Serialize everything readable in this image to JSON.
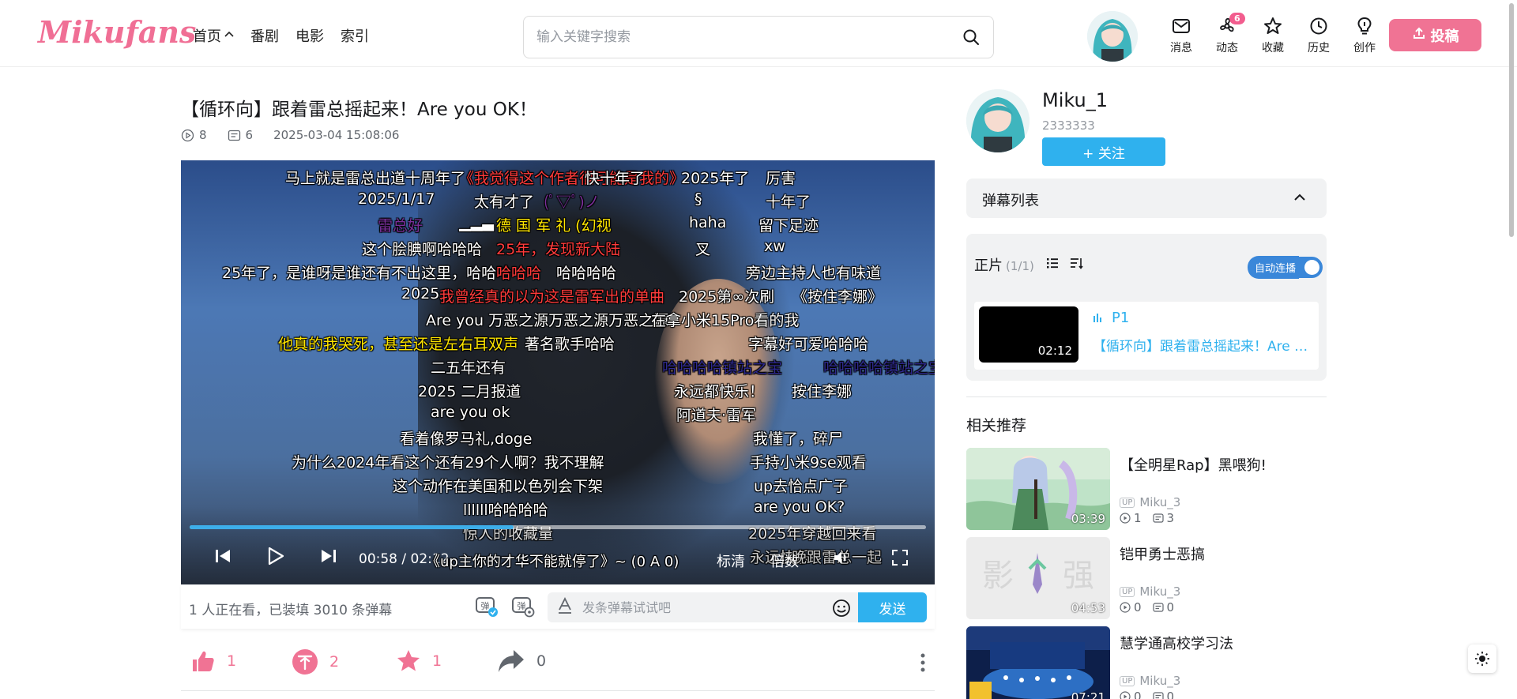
{
  "header": {
    "logo": "Mikufans",
    "nav": [
      {
        "label": "首页"
      },
      {
        "label": "番剧"
      },
      {
        "label": "电影"
      },
      {
        "label": "索引"
      }
    ],
    "search_placeholder": "输入关键字搜索",
    "actions": [
      {
        "label": "消息",
        "icon": "mail-icon"
      },
      {
        "label": "动态",
        "icon": "fan-icon",
        "badge": "6"
      },
      {
        "label": "收藏",
        "icon": "star-icon"
      },
      {
        "label": "历史",
        "icon": "clock-icon"
      },
      {
        "label": "创作",
        "icon": "bulb-icon"
      }
    ],
    "upload_label": "投稿"
  },
  "video": {
    "title": "【循环向】跟着雷总摇起来！Are you OK！",
    "plays": "8",
    "danmaku_count": "6",
    "date": "2025-03-04 15:08:06"
  },
  "player": {
    "current_time": "00:58",
    "duration": "02:12",
    "progress_fraction": 0.44,
    "quality": "标清",
    "speed": "倍数",
    "scrolling_danmaku": "《up主你的才华不能就停了》~  (0 A 0)",
    "danmaku": [
      {
        "text": "马上就是雷总出道十周年了",
        "color": "white"
      },
      {
        "text": "《我觉得这个作者很可能是我的》",
        "color": "red"
      },
      {
        "text": "快十年了",
        "color": "white"
      },
      {
        "text": "2025年了",
        "color": "white"
      },
      {
        "text": "厉害",
        "color": "white"
      },
      {
        "text": "2025/1/17",
        "color": "white"
      },
      {
        "text": "太有才了",
        "color": "white"
      },
      {
        "text": "(ﾟ▽ﾟ)ノ",
        "color": "purple"
      },
      {
        "text": "§",
        "color": "white"
      },
      {
        "text": "十年了",
        "color": "white"
      },
      {
        "text": "雷总好",
        "color": "purple"
      },
      {
        "text": "▁▂▃",
        "color": "white"
      },
      {
        "text": "德 国 军 礼 (幻视",
        "color": "yellow"
      },
      {
        "text": "haha",
        "color": "white"
      },
      {
        "text": "留下足迹",
        "color": "white"
      },
      {
        "text": "这个脍腆啊哈哈哈",
        "color": "white"
      },
      {
        "text": "25年，发现新大陆",
        "color": "red"
      },
      {
        "text": "叉",
        "color": "white"
      },
      {
        "text": "xw",
        "color": "white"
      },
      {
        "text": "25年了，是谁呀是谁还有不出这里，哈哈哈",
        "color": "white"
      },
      {
        "text": "哈哈哈",
        "color": "red"
      },
      {
        "text": "哈哈哈哈",
        "color": "white"
      },
      {
        "text": "旁边主持人也有味道",
        "color": "white"
      },
      {
        "text": "2025,",
        "color": "white"
      },
      {
        "text": "我曾经真的以为这是雷军出的单曲",
        "color": "red"
      },
      {
        "text": "2025第∞次刷",
        "color": "white"
      },
      {
        "text": "《按住李娜》",
        "color": "white"
      },
      {
        "text": "Are you 万恶之源万恶之源万恶之源",
        "color": "white"
      },
      {
        "text": "在拿小米15Pro看的我",
        "color": "white"
      },
      {
        "text": "他真的我哭死，甚至还是左右耳双声",
        "color": "yellow"
      },
      {
        "text": "著名歌手哈哈",
        "color": "white"
      },
      {
        "text": "字幕好可爱哈哈哈",
        "color": "white"
      },
      {
        "text": "二五年还有",
        "color": "white"
      },
      {
        "text": "哈哈哈哈镇站之宝",
        "color": "navy"
      },
      {
        "text": "哈哈哈哈镇站之宝",
        "color": "navy"
      },
      {
        "text": "2025 二月报道",
        "color": "white"
      },
      {
        "text": "永远都快乐！",
        "color": "white"
      },
      {
        "text": "按住李娜",
        "color": "white"
      },
      {
        "text": "are you ok",
        "color": "white"
      },
      {
        "text": "阿道夫·雷军",
        "color": "white"
      },
      {
        "text": "看着像罗马礼,doge",
        "color": "white"
      },
      {
        "text": "我懂了，碎尸",
        "color": "white"
      },
      {
        "text": "为什么2024年看这个还有29个人啊？我不理解",
        "color": "white"
      },
      {
        "text": "手持小米9se观看",
        "color": "white"
      },
      {
        "text": "这个动作在美国和以色列会下架",
        "color": "white"
      },
      {
        "text": "up去恰点广子",
        "color": "white"
      },
      {
        "text": "llllll哈哈哈哈",
        "color": "white"
      },
      {
        "text": "are you OK?",
        "color": "white"
      },
      {
        "text": "惊人的收藏量",
        "color": "white"
      },
      {
        "text": "2025年穿越回来看",
        "color": "white"
      },
      {
        "text": "永远快乐",
        "color": "white"
      },
      {
        "text": "晚跟雷总一起",
        "color": "white"
      }
    ]
  },
  "sendbar": {
    "viewer_text": "1 人正在看，已装填 3010 条弹幕",
    "input_placeholder": "发条弹幕试试吧",
    "send_label": "发送"
  },
  "actions": {
    "like": "1",
    "coin": "2",
    "favorite": "1",
    "share": "0"
  },
  "uploader": {
    "name": "Miku_1",
    "id": "2333333",
    "follow_label": "+ 关注"
  },
  "danmaku_list": {
    "title": "弹幕列表"
  },
  "episodes": {
    "title": "正片",
    "count": "(1/1)",
    "autoplay_label": "自动连播",
    "items": [
      {
        "name": "P1",
        "title": "【循环向】跟着雷总摇起来！Are you OK！",
        "duration": "02:12"
      }
    ]
  },
  "recommendations": {
    "title": "相关推荐",
    "items": [
      {
        "title": "【全明星Rap】黑喂狗!",
        "up": "Miku_3",
        "plays": "1",
        "danmaku": "3",
        "duration": "03:39"
      },
      {
        "title": "铠甲勇士恶搞",
        "up": "Miku_3",
        "plays": "0",
        "danmaku": "0",
        "duration": "04:53"
      },
      {
        "title": "慧学通高校学习法",
        "up": "Miku_3",
        "plays": "0",
        "danmaku": "0",
        "duration": "07:21"
      }
    ]
  },
  "colors": {
    "brand_pink": "#f07394",
    "accent_blue": "#2fb1ee"
  }
}
